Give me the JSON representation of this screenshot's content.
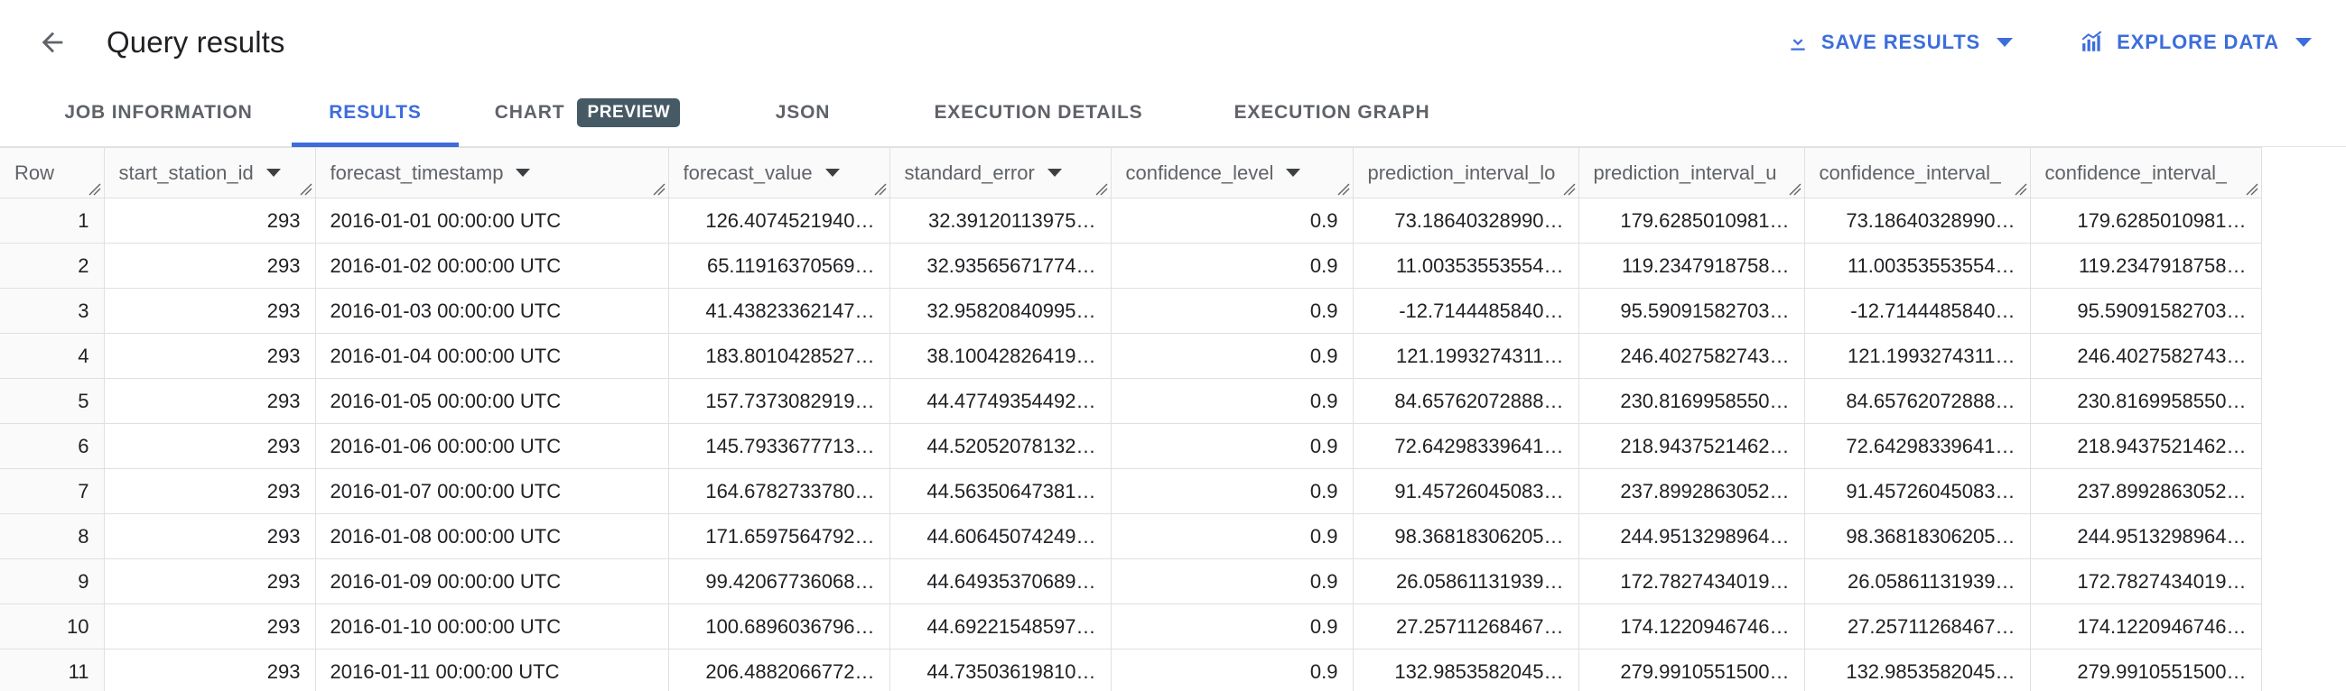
{
  "header": {
    "back_icon": "arrow-left-icon",
    "title": "Query results",
    "actions": [
      {
        "icon": "save-download-icon",
        "label": "SAVE RESULTS",
        "caret": true
      },
      {
        "icon": "explore-chart-icon",
        "label": "EXPLORE DATA",
        "caret": true
      }
    ]
  },
  "tabs": [
    {
      "label": "JOB INFORMATION",
      "active": false,
      "badge": null
    },
    {
      "label": "RESULTS",
      "active": true,
      "badge": null
    },
    {
      "label": "CHART",
      "active": false,
      "badge": "PREVIEW"
    },
    {
      "label": "JSON",
      "active": false,
      "badge": null
    },
    {
      "label": "EXECUTION DETAILS",
      "active": false,
      "badge": null
    },
    {
      "label": "EXECUTION GRAPH",
      "active": false,
      "badge": null
    }
  ],
  "colors": {
    "accent": "#3c6ddb",
    "badge_bg": "#465a65",
    "header_text": "#5f6368",
    "grid": "#e0e0e0",
    "row_header_bg": "#fafafa"
  },
  "table": {
    "columns": [
      {
        "key": "row",
        "label": "Row",
        "sortable": false,
        "resizable": true,
        "align": "right"
      },
      {
        "key": "ssid",
        "label": "start_station_id",
        "sortable": true,
        "resizable": true,
        "align": "right"
      },
      {
        "key": "fts",
        "label": "forecast_timestamp",
        "sortable": true,
        "resizable": true,
        "align": "left"
      },
      {
        "key": "fval",
        "label": "forecast_value",
        "sortable": true,
        "resizable": true,
        "align": "right"
      },
      {
        "key": "serr",
        "label": "standard_error",
        "sortable": true,
        "resizable": true,
        "align": "right"
      },
      {
        "key": "conf",
        "label": "confidence_level",
        "sortable": true,
        "resizable": true,
        "align": "right"
      },
      {
        "key": "pil",
        "label": "prediction_interval_lo",
        "sortable": false,
        "resizable": true,
        "align": "right"
      },
      {
        "key": "piu",
        "label": "prediction_interval_u",
        "sortable": false,
        "resizable": true,
        "align": "right"
      },
      {
        "key": "cil",
        "label": "confidence_interval_",
        "sortable": false,
        "resizable": true,
        "align": "right"
      },
      {
        "key": "ciu",
        "label": "confidence_interval_",
        "sortable": false,
        "resizable": true,
        "align": "right"
      }
    ],
    "rows": [
      {
        "row": "1",
        "ssid": "293",
        "fts": "2016-01-01 00:00:00 UTC",
        "fval": "126.4074521940…",
        "serr": "32.39120113975…",
        "conf": "0.9",
        "pil": "73.18640328990…",
        "piu": "179.6285010981…",
        "cil": "73.18640328990…",
        "ciu": "179.6285010981…"
      },
      {
        "row": "2",
        "ssid": "293",
        "fts": "2016-01-02 00:00:00 UTC",
        "fval": "65.11916370569…",
        "serr": "32.93565671774…",
        "conf": "0.9",
        "pil": "11.00353553554…",
        "piu": "119.2347918758…",
        "cil": "11.00353553554…",
        "ciu": "119.2347918758…"
      },
      {
        "row": "3",
        "ssid": "293",
        "fts": "2016-01-03 00:00:00 UTC",
        "fval": "41.43823362147…",
        "serr": "32.95820840995…",
        "conf": "0.9",
        "pil": "-12.7144485840…",
        "piu": "95.59091582703…",
        "cil": "-12.7144485840…",
        "ciu": "95.59091582703…"
      },
      {
        "row": "4",
        "ssid": "293",
        "fts": "2016-01-04 00:00:00 UTC",
        "fval": "183.8010428527…",
        "serr": "38.10042826419…",
        "conf": "0.9",
        "pil": "121.1993274311…",
        "piu": "246.4027582743…",
        "cil": "121.1993274311…",
        "ciu": "246.4027582743…"
      },
      {
        "row": "5",
        "ssid": "293",
        "fts": "2016-01-05 00:00:00 UTC",
        "fval": "157.7373082919…",
        "serr": "44.47749354492…",
        "conf": "0.9",
        "pil": "84.65762072888…",
        "piu": "230.8169958550…",
        "cil": "84.65762072888…",
        "ciu": "230.8169958550…"
      },
      {
        "row": "6",
        "ssid": "293",
        "fts": "2016-01-06 00:00:00 UTC",
        "fval": "145.7933677713…",
        "serr": "44.52052078132…",
        "conf": "0.9",
        "pil": "72.64298339641…",
        "piu": "218.9437521462…",
        "cil": "72.64298339641…",
        "ciu": "218.9437521462…"
      },
      {
        "row": "7",
        "ssid": "293",
        "fts": "2016-01-07 00:00:00 UTC",
        "fval": "164.6782733780…",
        "serr": "44.56350647381…",
        "conf": "0.9",
        "pil": "91.45726045083…",
        "piu": "237.8992863052…",
        "cil": "91.45726045083…",
        "ciu": "237.8992863052…"
      },
      {
        "row": "8",
        "ssid": "293",
        "fts": "2016-01-08 00:00:00 UTC",
        "fval": "171.6597564792…",
        "serr": "44.60645074249…",
        "conf": "0.9",
        "pil": "98.36818306205…",
        "piu": "244.9513298964…",
        "cil": "98.36818306205…",
        "ciu": "244.9513298964…"
      },
      {
        "row": "9",
        "ssid": "293",
        "fts": "2016-01-09 00:00:00 UTC",
        "fval": "99.42067736068…",
        "serr": "44.64935370689…",
        "conf": "0.9",
        "pil": "26.05861131939…",
        "piu": "172.7827434019…",
        "cil": "26.05861131939…",
        "ciu": "172.7827434019…"
      },
      {
        "row": "10",
        "ssid": "293",
        "fts": "2016-01-10 00:00:00 UTC",
        "fval": "100.6896036796…",
        "serr": "44.69221548597…",
        "conf": "0.9",
        "pil": "27.25711268467…",
        "piu": "174.1220946746…",
        "cil": "27.25711268467…",
        "ciu": "174.1220946746…"
      },
      {
        "row": "11",
        "ssid": "293",
        "fts": "2016-01-11 00:00:00 UTC",
        "fval": "206.4882066772…",
        "serr": "44.73503619810…",
        "conf": "0.9",
        "pil": "132.9853582045…",
        "piu": "279.9910551500…",
        "cil": "132.9853582045…",
        "ciu": "279.9910551500…"
      }
    ]
  }
}
